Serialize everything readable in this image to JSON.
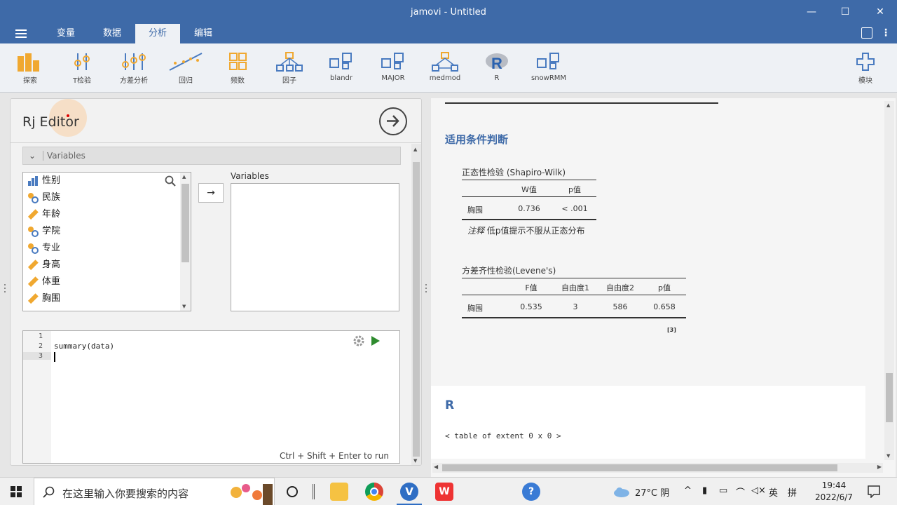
{
  "window": {
    "title": "jamovi - Untitled"
  },
  "menu": {
    "tabs": [
      {
        "label": "变量"
      },
      {
        "label": "数据"
      },
      {
        "label": "分析"
      },
      {
        "label": "编辑"
      }
    ]
  },
  "ribbon": {
    "items": [
      {
        "label": "探索",
        "icon": "explore-icon"
      },
      {
        "label": "T检验",
        "icon": "ttest-icon"
      },
      {
        "label": "方差分析",
        "icon": "anova-icon"
      },
      {
        "label": "回归",
        "icon": "regression-icon"
      },
      {
        "label": "频数",
        "icon": "frequencies-icon"
      },
      {
        "label": "因子",
        "icon": "factor-icon"
      },
      {
        "label": "blandr",
        "icon": "module-icon"
      },
      {
        "label": "MAJOR",
        "icon": "module-icon"
      },
      {
        "label": "medmod",
        "icon": "medmod-icon"
      },
      {
        "label": "R",
        "icon": "r-logo-icon"
      },
      {
        "label": "snowRMM",
        "icon": "module-icon"
      }
    ],
    "modules_label": "模块"
  },
  "editor_panel": {
    "title": "Rj Editor",
    "variables_header": "Variables",
    "source_variables": [
      {
        "name": "性别",
        "type": "nominal-bar"
      },
      {
        "name": "民族",
        "type": "nominal"
      },
      {
        "name": "年龄",
        "type": "continuous"
      },
      {
        "name": "学院",
        "type": "nominal"
      },
      {
        "name": "专业",
        "type": "nominal"
      },
      {
        "name": "身高",
        "type": "continuous"
      },
      {
        "name": "体重",
        "type": "continuous"
      },
      {
        "name": "胸围",
        "type": "continuous"
      }
    ],
    "target_label": "Variables",
    "code": {
      "line_numbers": [
        "1",
        "2",
        "3"
      ],
      "line2": "summary(data)"
    },
    "run_hint": "Ctrl + Shift + Enter to run"
  },
  "results": {
    "section_title": "适用条件判断",
    "normality": {
      "title": "正态性检验 (Shapiro-Wilk)",
      "headers": [
        "W值",
        "p值"
      ],
      "row": {
        "label": "胸围",
        "w": "0.736",
        "p": "< .001"
      },
      "note_label": "注释",
      "note_text": " 低p值提示不服从正态分布"
    },
    "levene": {
      "title": "方差齐性检验(Levene's)",
      "headers": [
        "F值",
        "自由度1",
        "自由度2",
        "p值"
      ],
      "row": {
        "label": "胸围",
        "f": "0.535",
        "df1": "3",
        "df2": "586",
        "p": "0.658"
      },
      "ref": "[3]"
    },
    "r_output": {
      "title": "R",
      "text": "< table of extent 0 x 0 >"
    }
  },
  "taskbar": {
    "search_placeholder": "在这里输入你要搜索的内容",
    "weather": "27°C 阴",
    "ime": "英",
    "ime2": "拼",
    "time": "19:44",
    "date": "2022/6/7"
  },
  "colors": {
    "accent": "#3e6aa8",
    "ribbon": "#eef1f5",
    "orange": "#f0a830"
  }
}
